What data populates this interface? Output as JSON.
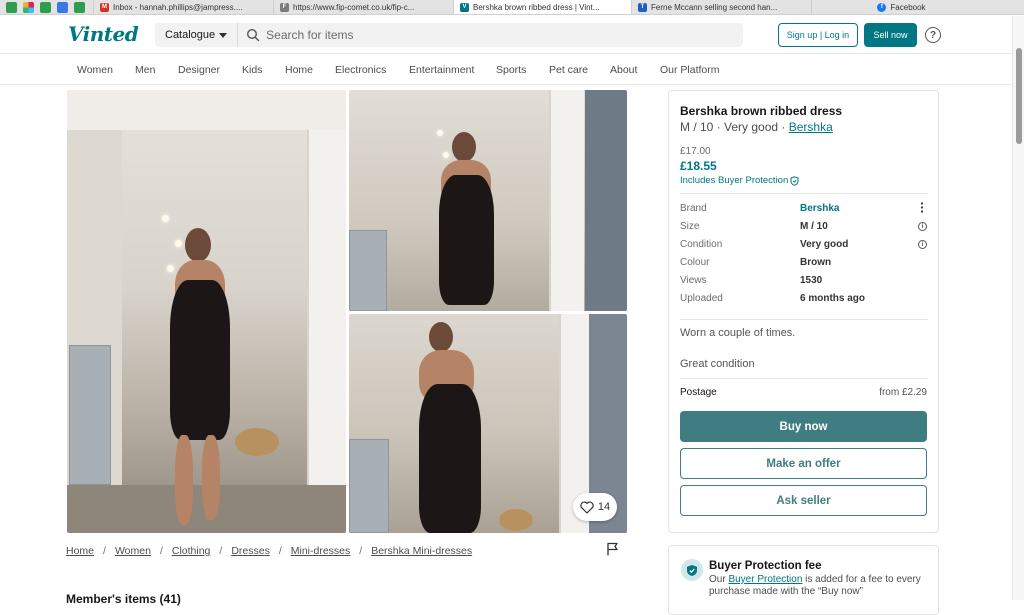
{
  "browser": {
    "tabs": [
      {
        "label": "Inbox - hannah.phillips@jampress....",
        "favicon": "gmail-icon",
        "color": "#d93025",
        "letter": "M"
      },
      {
        "label": "https://www.fip-comet.co.uk/fip-c...",
        "favicon": "site-icon",
        "color": "#7a7a7a",
        "letter": "F"
      },
      {
        "label": "Bershka brown ribbed dress | Vint...",
        "favicon": "vinted-icon",
        "color": "#007782",
        "letter": "V",
        "active": true
      },
      {
        "label": "Ferne Mccann selling second han...",
        "favicon": "trello-icon",
        "color": "#1f5fbf",
        "letter": "T"
      },
      {
        "label": "Facebook",
        "favicon": "facebook-icon",
        "color": "#1877f2",
        "letter": "f"
      }
    ]
  },
  "header": {
    "logo": "Vinted",
    "catalogue_label": "Catalogue",
    "search_placeholder": "Search for items",
    "signup_label": "Sign up | Log in",
    "sell_label": "Sell now",
    "help_glyph": "?"
  },
  "nav": {
    "items": [
      "Women",
      "Men",
      "Designer",
      "Kids",
      "Home",
      "Electronics",
      "Entertainment",
      "Sports",
      "Pet care",
      "About",
      "Our Platform"
    ]
  },
  "gallery": {
    "likes": "14"
  },
  "breadcrumb": [
    "Home",
    "Women",
    "Clothing",
    "Dresses",
    "Mini-dresses",
    "Bershka Mini-dresses"
  ],
  "members_heading": "Member's items (41)",
  "item": {
    "title": "Bershka brown ribbed dress",
    "subtitle_prefix": "M / 10 · Very good · ",
    "brand_link": "Bershka",
    "price_original": "£17.00",
    "price_total": "£18.55",
    "buyer_protection": "Includes Buyer Protection",
    "details": [
      {
        "label": "Brand",
        "value": "Bershka"
      },
      {
        "label": "Size",
        "value": "M / 10"
      },
      {
        "label": "Condition",
        "value": "Very good"
      },
      {
        "label": "Colour",
        "value": "Brown"
      },
      {
        "label": "Views",
        "value": "1530"
      },
      {
        "label": "Uploaded",
        "value": "6 months ago"
      }
    ],
    "description_1": "Worn a couple of times.",
    "description_2": "Great condition",
    "postage_label": "Postage",
    "postage_value": "from £2.29",
    "buy_label": "Buy now",
    "offer_label": "Make an offer",
    "ask_label": "Ask seller"
  },
  "fee": {
    "title": "Buyer Protection fee",
    "text_prefix": "Our ",
    "link": "Buyer Protection",
    "text_suffix": " is added for a fee to every purchase made with the “Buy now”"
  },
  "colors": {
    "brand": "#007782",
    "button": "#3f7d82"
  }
}
